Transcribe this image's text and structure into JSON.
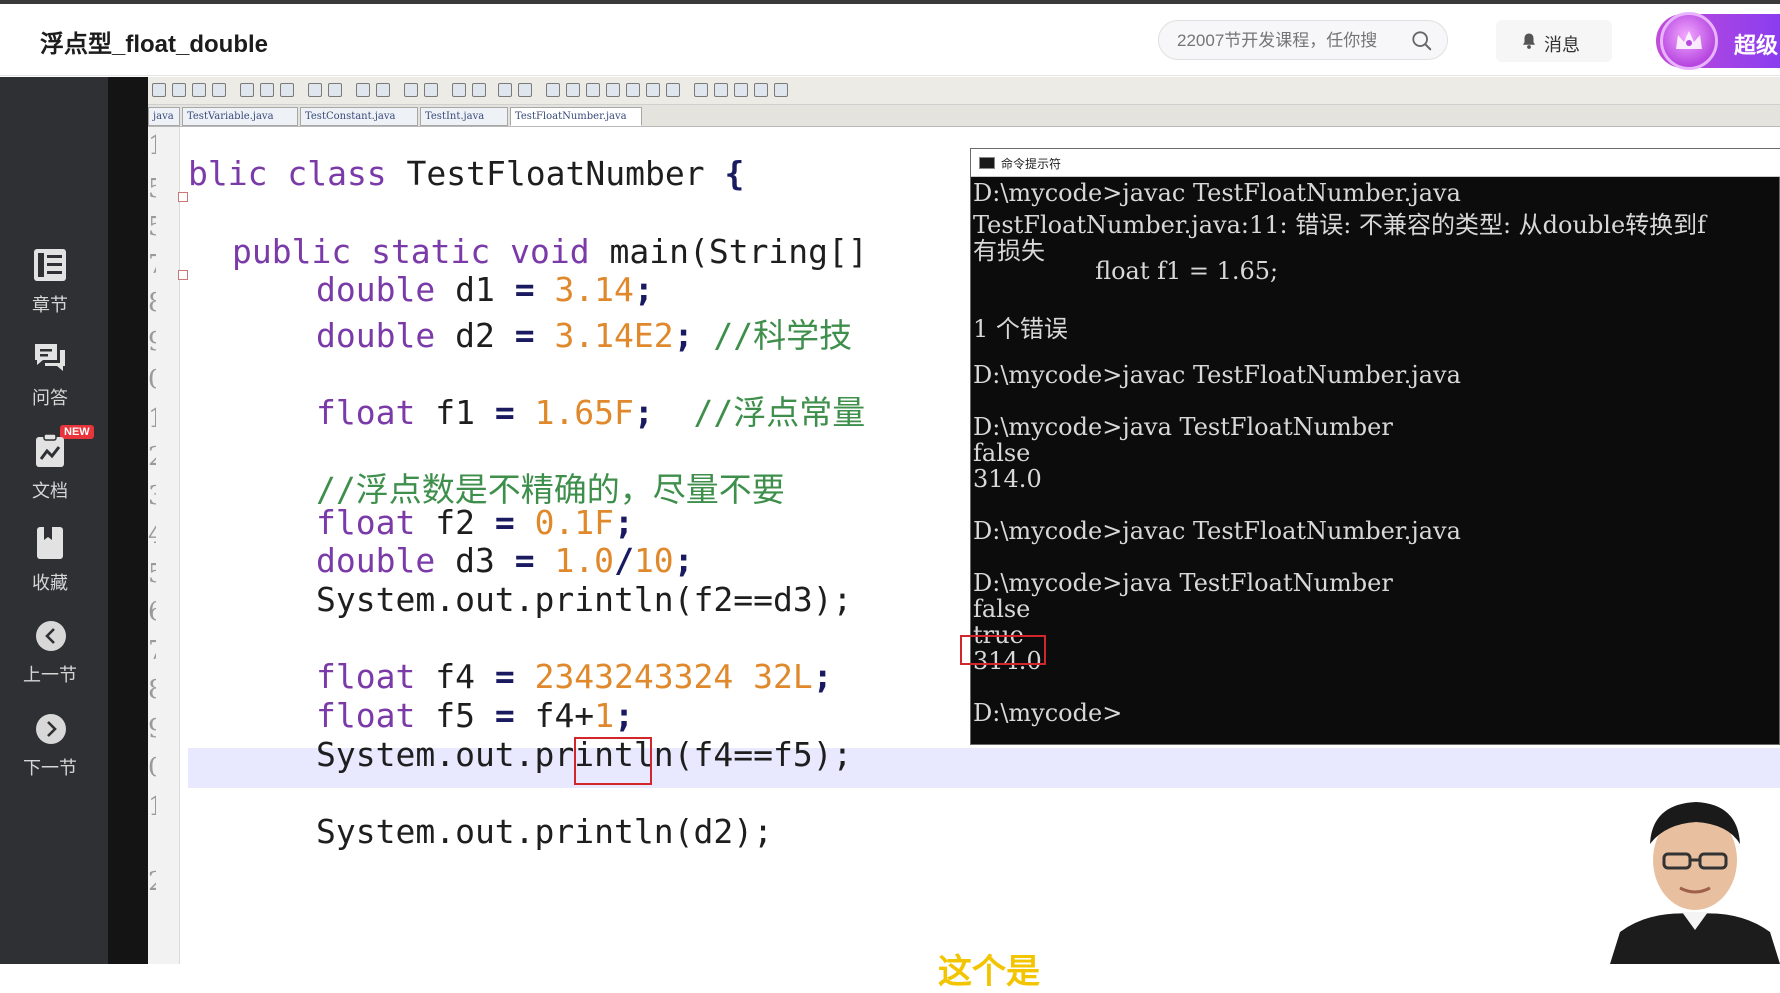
{
  "header": {
    "course_title": "浮点型_float_double",
    "search_placeholder": "22007节开发课程，任你搜",
    "messages_label": "消息",
    "vip_label": "超级"
  },
  "sidebar": {
    "items": [
      {
        "label": "章节",
        "icon": "chapter-list-icon"
      },
      {
        "label": "问答",
        "icon": "qa-chat-icon"
      },
      {
        "label": "文档",
        "icon": "document-icon",
        "badge": "NEW"
      },
      {
        "label": "收藏",
        "icon": "bookmark-icon"
      },
      {
        "label": "上一节",
        "icon": "chevron-left-icon"
      },
      {
        "label": "下一节",
        "icon": "chevron-right-icon"
      }
    ]
  },
  "editor": {
    "tabs": [
      {
        "label": "java"
      },
      {
        "label": "TestVariable.java"
      },
      {
        "label": "TestConstant.java"
      },
      {
        "label": "TestInt.java"
      },
      {
        "label": "TestFloatNumber.java",
        "active": true
      }
    ],
    "line_numbers": [
      "1",
      "5",
      "5",
      "7",
      "8",
      "9",
      "0",
      "1",
      "2",
      "3",
      "4",
      "5",
      "6",
      "7",
      "8",
      "9",
      "0",
      "1",
      "2"
    ],
    "code": {
      "class_decl_kw": "blic class",
      "class_name": " TestFloatNumber ",
      "brace": "{",
      "main_kw": "public static void",
      "main_rest": " main(String[] ",
      "l_d1_kw": "double",
      "l_d1_var": " d1 ",
      "l_d1_eq": "=",
      "l_d1_val": " 3.14",
      "l_d1_end": ";",
      "l_d2_kw": "double",
      "l_d2_var": " d2 ",
      "l_d2_eq": "=",
      "l_d2_val": " 3.14E2",
      "l_d2_end": "; ",
      "l_d2_cmt": "//科学技",
      "l_f1_kw": "float",
      "l_f1_var": " f1 ",
      "l_f1_eq": "=",
      "l_f1_val": " 1.65F",
      "l_f1_end": ";  ",
      "l_f1_cmt": "//浮点常量",
      "cmt_line": "//浮点数是不精确的，尽量不要",
      "l_f2_kw": "float",
      "l_f2_var": " f2 ",
      "l_f2_eq": "=",
      "l_f2_val": " 0.1F",
      "l_f2_end": ";",
      "l_d3_kw": "double",
      "l_d3_var": " d3 ",
      "l_d3_eq": "=",
      "l_d3_val1": " 1.0",
      "l_d3_slash": "/",
      "l_d3_val2": "10",
      "l_d3_end": ";",
      "println1": "System.out.println(f2==d3);",
      "l_f4_kw": "float",
      "l_f4_var": " f4 ",
      "l_f4_eq": "=",
      "l_f4_val": " 2343243324 32L",
      "l_f4_end": ";",
      "l_f5_kw": "float",
      "l_f5_var": " f5 ",
      "l_f5_eq": "=",
      "l_f5_expr": " f4+",
      "l_f5_val": "1",
      "l_f5_end": ";",
      "println2": "System.out.println(f4==f5);",
      "println3": "System.out.println(d2);"
    }
  },
  "console": {
    "title": "命令提示符",
    "lines": [
      "D:\\mycode>javac TestFloatNumber.java",
      "TestFloatNumber.java:11: 错误: 不兼容的类型: 从double转换到f",
      "有损失",
      "                float f1 = 1.65;",
      "",
      "1 个错误",
      "",
      "D:\\mycode>javac TestFloatNumber.java",
      "",
      "D:\\mycode>java TestFloatNumber",
      "false",
      "314.0",
      "",
      "D:\\mycode>javac TestFloatNumber.java",
      "",
      "D:\\mycode>java TestFloatNumber",
      "false",
      "true",
      "314.0",
      "",
      "D:\\mycode>"
    ]
  },
  "subtitle_fragment": "这个是",
  "colors": {
    "keyword": "#7a3aa8",
    "number": "#e0882c",
    "comment": "#3f8f4c",
    "highlight_box": "#d2262c",
    "sidebar_bg": "#2f3033",
    "console_bg": "#0c0c0c"
  }
}
